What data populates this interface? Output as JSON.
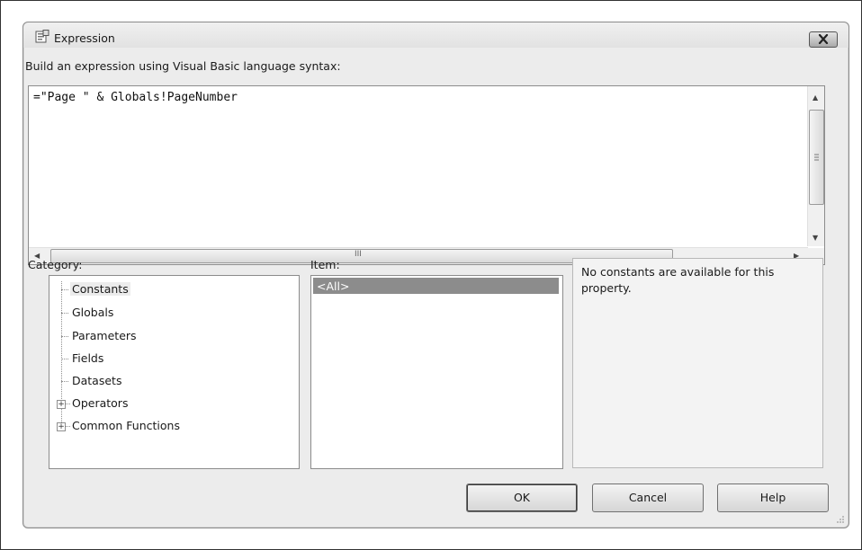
{
  "window": {
    "title": "Expression",
    "icon": "expression-window-icon"
  },
  "editor": {
    "prompt": "Build an expression using Visual Basic language syntax:",
    "value": "=\"Page \" & Globals!PageNumber"
  },
  "category": {
    "label": "Category:",
    "items": [
      "Constants",
      "Globals",
      "Parameters",
      "Fields",
      "Datasets",
      "Operators",
      "Common Functions"
    ],
    "selected": "Constants"
  },
  "item": {
    "label": "Item:",
    "items": [
      "<All>"
    ],
    "selected": "<All>"
  },
  "description": {
    "text": "No constants are available for this property."
  },
  "buttons": {
    "ok": "OK",
    "cancel": "Cancel",
    "help": "Help"
  },
  "scrollbar": {
    "h_thumb_grip": "III"
  }
}
